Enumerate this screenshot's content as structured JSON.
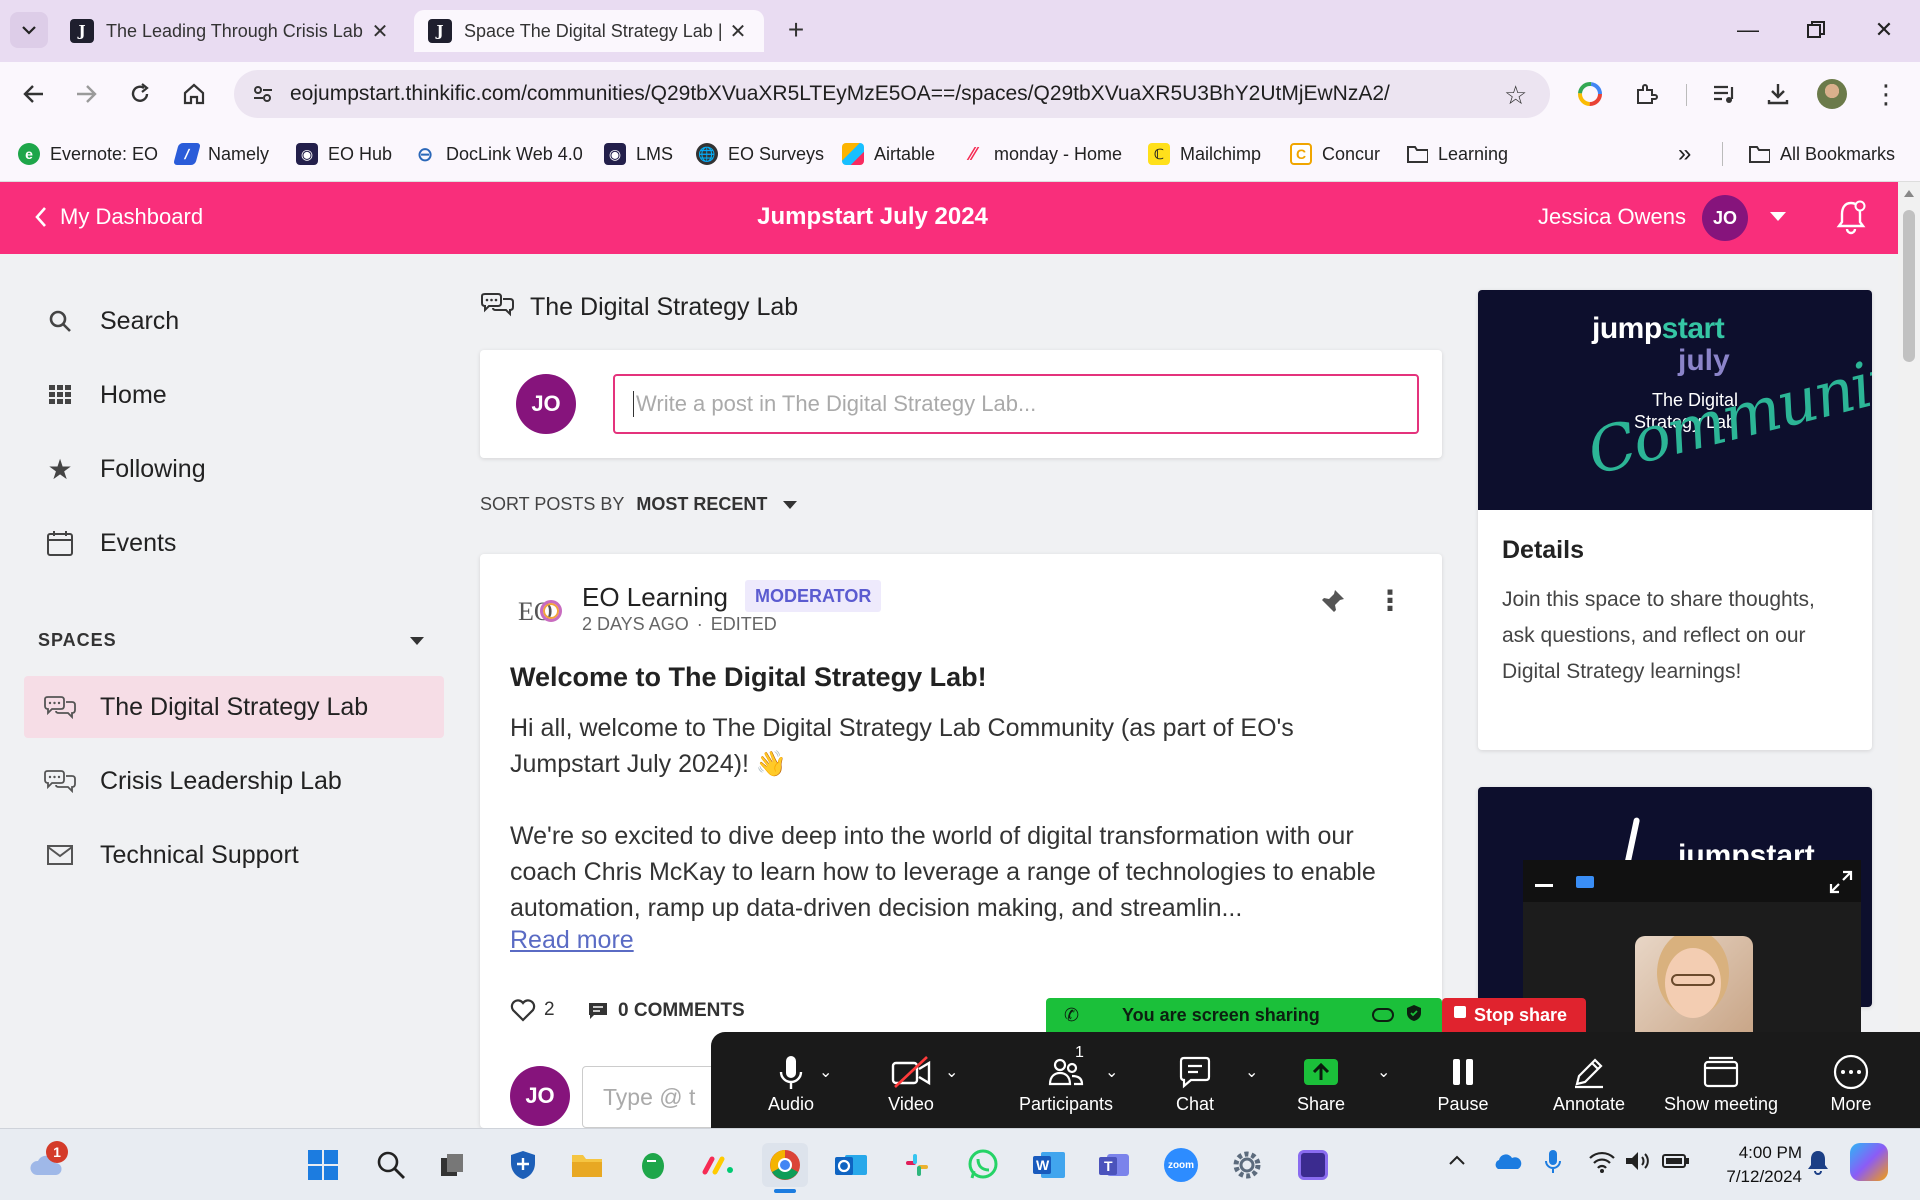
{
  "browser": {
    "tabs": [
      {
        "title": "The Leading Through Crisis Lab",
        "active": false
      },
      {
        "title": "Space The Digital Strategy Lab |",
        "active": true
      }
    ],
    "url": "eojumpstart.thinkific.com/communities/Q29tbXVuaXR5LTEyMzE5OA==/spaces/Q29tbXVuaXR5U3BhY2UtMjEwNzA2/",
    "bookmarks": [
      "Evernote: EO",
      "Namely",
      "EO Hub",
      "DocLink Web 4.0",
      "LMS",
      "EO Surveys",
      "Airtable",
      "monday - Home",
      "Mailchimp",
      "Concur",
      "Learning"
    ],
    "all_bookmarks": "All Bookmarks",
    "overflow": "»"
  },
  "header": {
    "back_label": "My Dashboard",
    "course_title": "Jumpstart July 2024",
    "user_name": "Jessica Owens",
    "user_initials": "JO"
  },
  "sidebar": {
    "nav": [
      {
        "label": "Search",
        "icon": "search-icon"
      },
      {
        "label": "Home",
        "icon": "grid-icon"
      },
      {
        "label": "Following",
        "icon": "star-icon"
      },
      {
        "label": "Events",
        "icon": "calendar-icon"
      }
    ],
    "spaces_label": "SPACES",
    "spaces": [
      {
        "label": "The Digital Strategy Lab",
        "icon": "chat-bubbles-icon",
        "active": true
      },
      {
        "label": "Crisis Leadership Lab",
        "icon": "chat-bubbles-icon",
        "active": false
      },
      {
        "label": "Technical Support",
        "icon": "envelope-icon",
        "active": false
      }
    ]
  },
  "main": {
    "space_title": "The Digital Strategy Lab",
    "composer": {
      "initials": "JO",
      "placeholder": "Write a post in The Digital Strategy Lab..."
    },
    "sort": {
      "label": "SORT POSTS BY",
      "value": "MOST RECENT"
    },
    "post": {
      "author": "EO Learning",
      "author_logo": "EO",
      "role_badge": "MODERATOR",
      "time": "2 DAYS AGO",
      "edited": "EDITED",
      "separator": "·",
      "title": "Welcome to The Digital Strategy Lab!",
      "paragraph1": "Hi all, welcome to The Digital Strategy Lab Community (as part of EO's Jumpstart July 2024)! 👋",
      "paragraph2": "We're so excited to dive deep into the world of digital transformation with our coach Chris McKay to learn how to leverage a range of technologies to enable automation, ramp up data-driven decision making, and streamlin...",
      "read_more": "Read more",
      "likes": "2",
      "comments": "0 COMMENTS",
      "reply_initials": "JO",
      "reply_placeholder": "Type @ t"
    }
  },
  "right": {
    "banner": {
      "line1": "jump",
      "line1b": "start",
      "line2": "july",
      "line3": "The Digital",
      "line4": "Strategy Lab",
      "script": "Community"
    },
    "details_title": "Details",
    "details_text": "Join this space to share thoughts, ask questions, and reflect on our Digital Strategy learnings!",
    "banner2_text": "jumpstart"
  },
  "zoom": {
    "sharing_text": "You are screen sharing",
    "stop_share": "Stop share",
    "participants_count": "1",
    "buttons": [
      "Audio",
      "Video",
      "Participants",
      "Chat",
      "Share",
      "Pause",
      "Annotate",
      "Show meeting",
      "More"
    ]
  },
  "taskbar": {
    "notification_badge": "1",
    "time": "4:00 PM",
    "date": "7/12/2024",
    "zoom_label": "zoom"
  },
  "colors": {
    "brand_pink": "#f92e7b",
    "avatar_purple": "#86147c",
    "moderator_bg": "#eeeafc",
    "moderator_text": "#5b5bd0",
    "zoom_green": "#1bc03a",
    "zoom_red": "#e0232e"
  }
}
